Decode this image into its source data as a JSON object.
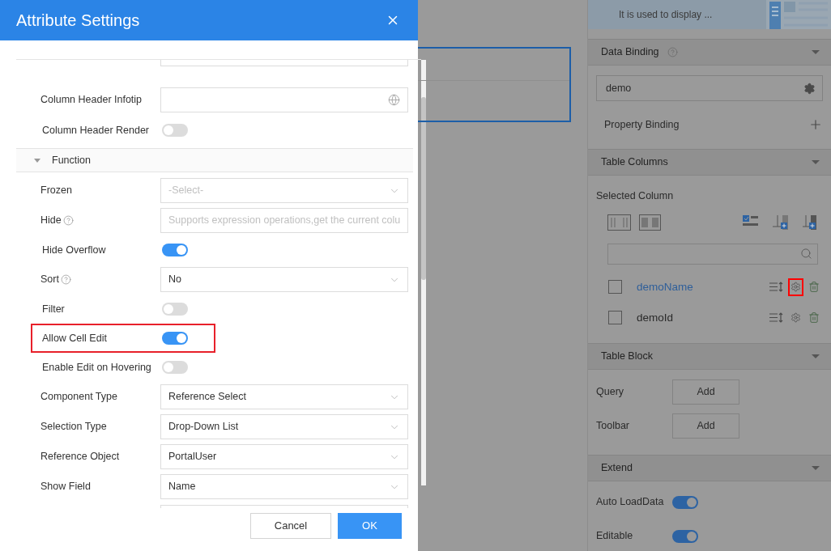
{
  "dialog": {
    "title": "Attribute Settings",
    "rows": [
      {
        "kind": "stub"
      },
      {
        "kind": "globe-input",
        "label": "Column Header Infotip",
        "value": ""
      },
      {
        "kind": "toggle",
        "label": "Column Header Render",
        "on": false,
        "highlighted": false
      },
      {
        "kind": "group",
        "label": "Function",
        "expanded": true
      },
      {
        "kind": "select",
        "label": "Frozen",
        "placeholder": "-Select-",
        "help": false
      },
      {
        "kind": "input",
        "label": "Hide",
        "placeholder": "Supports expression operations,get the current colu",
        "help": true
      },
      {
        "kind": "toggle",
        "label": "Hide Overflow",
        "on": true,
        "highlighted": false
      },
      {
        "kind": "select",
        "label": "Sort",
        "value": "No",
        "help": true
      },
      {
        "kind": "toggle",
        "label": "Filter",
        "on": false,
        "highlighted": false
      },
      {
        "kind": "toggle",
        "label": "Allow Cell Edit",
        "on": true,
        "highlighted": true
      },
      {
        "kind": "toggle",
        "label": "Enable Edit on Hovering",
        "on": false,
        "highlighted": false
      },
      {
        "kind": "select",
        "label": "Component Type",
        "value": "Reference Select",
        "help": false
      },
      {
        "kind": "select",
        "label": "Selection Type",
        "value": "Drop-Down List",
        "help": false
      },
      {
        "kind": "select",
        "label": "Reference Object",
        "value": "PortalUser",
        "help": false
      },
      {
        "kind": "select",
        "label": "Show Field",
        "value": "Name",
        "help": false
      },
      {
        "kind": "stub-bottom"
      }
    ],
    "buttons": [
      {
        "label": "Cancel",
        "kind": "secondary"
      },
      {
        "label": "OK",
        "kind": "primary"
      }
    ]
  },
  "panel": {
    "banner": {
      "text": "It is used to display ..."
    },
    "sections": [
      {
        "kind": "binding",
        "title": "Data Binding",
        "help": true,
        "expanded": true,
        "dataset": "demo",
        "property_label": "Property Binding"
      },
      {
        "kind": "columns",
        "title": "Table Columns",
        "help": false,
        "expanded": true,
        "subtitle": "Selected Column",
        "columns": [
          {
            "name": "demoName",
            "checked": false,
            "selected": true,
            "settings_highlighted": true
          },
          {
            "name": "demoId",
            "checked": false,
            "selected": false,
            "settings_highlighted": false
          }
        ]
      },
      {
        "kind": "blocks",
        "title": "Table Block",
        "help": false,
        "expanded": true,
        "items": [
          {
            "label": "Query",
            "button": "Add"
          },
          {
            "label": "Toolbar",
            "button": "Add"
          }
        ]
      },
      {
        "kind": "switches",
        "title": "Extend",
        "help": false,
        "expanded": true,
        "items": [
          {
            "label": "Auto LoadData",
            "on": true
          },
          {
            "label": "Editable",
            "on": true
          }
        ]
      }
    ]
  }
}
